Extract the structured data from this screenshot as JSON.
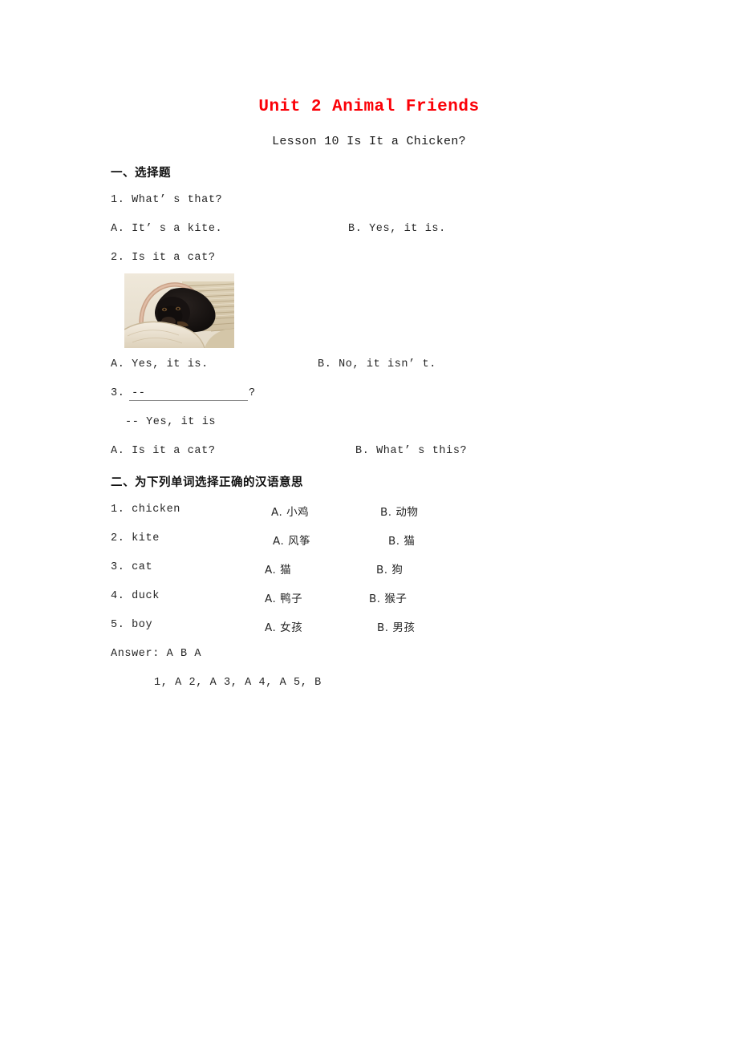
{
  "document": {
    "title": "Unit 2 Animal Friends",
    "subtitle": "Lesson 10 Is It a Chicken?",
    "title_color": "#fb0007"
  },
  "section_one": {
    "heading": "一、选择题",
    "questions": [
      {
        "number": "1",
        "stem": "1. What’ s that?",
        "option_a": "A. It’ s a kite.",
        "option_b": "B. Yes, it is."
      },
      {
        "number": "2",
        "stem": "2. Is it a cat?",
        "image_alt": "black-dog-in-wicker-basket",
        "option_a": "A. Yes, it is.",
        "option_b": "B. No, it isn’ t."
      },
      {
        "number": "3",
        "stem_prefix": "3.  --",
        "stem_suffix": "?",
        "stem_reply": "-- Yes, it is",
        "option_a": "A. Is it a cat?",
        "option_b": "B. What’ s this?"
      }
    ]
  },
  "section_two": {
    "heading": "二、为下列单词选择正确的汉语意思",
    "items": [
      {
        "word": "1. chicken",
        "option_a": "A. 小鸡",
        "option_b": "B. 动物"
      },
      {
        "word": "2. kite",
        "option_a": "A. 风筝",
        "option_b": "B. 猫"
      },
      {
        "word": "3. cat",
        "option_a": "A. 猫",
        "option_b": "B. 狗"
      },
      {
        "word": "4. duck",
        "option_a": "A. 鸭子",
        "option_b": "B. 猴子"
      },
      {
        "word": "5. boy",
        "option_a": "A. 女孩",
        "option_b": "B. 男孩"
      }
    ]
  },
  "answers": {
    "line_one": "Answer: A   B   A",
    "line_two": "1, A   2, A   3, A   4, A   5, B"
  }
}
